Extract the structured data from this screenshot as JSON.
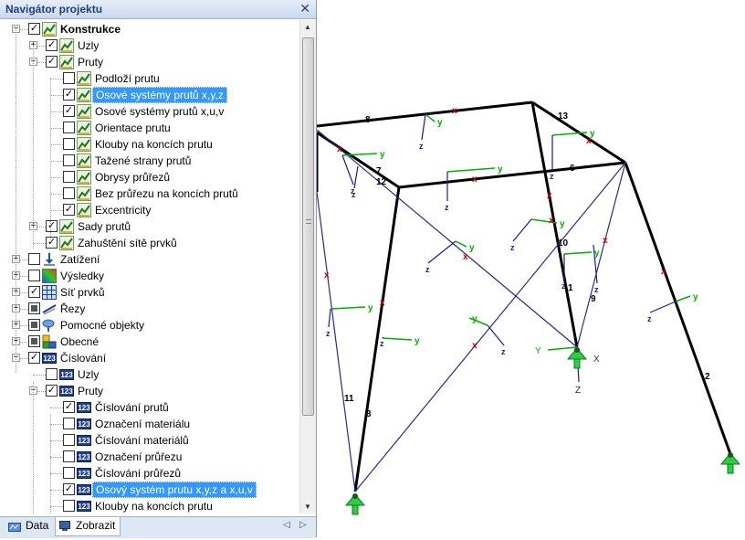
{
  "navigator": {
    "title": "Navigátor projektu",
    "close_glyph": "✕",
    "items": [
      {
        "label": "Konstrukce",
        "level": 1,
        "expander": "minus",
        "checkbox": "checked",
        "icon": "structure-icon",
        "bold": true
      },
      {
        "label": "Uzly",
        "level": 2,
        "expander": "plus",
        "checkbox": "checked",
        "icon": "structure-icon"
      },
      {
        "label": "Pruty",
        "level": 2,
        "expander": "minus",
        "checkbox": "checked",
        "icon": "structure-icon"
      },
      {
        "label": "Podloží prutu",
        "level": 3,
        "checkbox": "unchecked",
        "icon": "structure-icon"
      },
      {
        "label": "Osové systémy prutů x,y,z",
        "level": 3,
        "checkbox": "checked",
        "icon": "structure-icon",
        "selected": true
      },
      {
        "label": "Osové systémy prutů x,u,v",
        "level": 3,
        "checkbox": "checked",
        "icon": "structure-icon"
      },
      {
        "label": "Orientace prutu",
        "level": 3,
        "checkbox": "unchecked",
        "icon": "structure-icon"
      },
      {
        "label": "Klouby na koncích prutu",
        "level": 3,
        "checkbox": "unchecked",
        "icon": "structure-icon"
      },
      {
        "label": "Tažené strany prutů",
        "level": 3,
        "checkbox": "unchecked",
        "icon": "structure-icon"
      },
      {
        "label": "Obrysy průřezů",
        "level": 3,
        "checkbox": "unchecked",
        "icon": "structure-icon"
      },
      {
        "label": "Bez průřezu na koncích prutů",
        "level": 3,
        "checkbox": "unchecked",
        "icon": "structure-icon"
      },
      {
        "label": "Excentricity",
        "level": 3,
        "checkbox": "checked",
        "icon": "structure-icon"
      },
      {
        "label": "Sady prutů",
        "level": 2,
        "expander": "plus",
        "checkbox": "checked",
        "icon": "structure-icon"
      },
      {
        "label": "Zahuštění sítě prvků",
        "level": 2,
        "checkbox": "checked",
        "icon": "structure-icon"
      },
      {
        "label": "Zatížení",
        "level": 1,
        "expander": "plus",
        "checkbox": "unchecked",
        "icon": "load-icon"
      },
      {
        "label": "Výsledky",
        "level": 1,
        "expander": "plus",
        "checkbox": "unchecked",
        "icon": "results-icon"
      },
      {
        "label": "Síť prvků",
        "level": 1,
        "expander": "plus",
        "checkbox": "checked",
        "icon": "mesh-icon"
      },
      {
        "label": "Řezy",
        "level": 1,
        "expander": "plus",
        "checkbox": "partial",
        "icon": "section-cut-icon"
      },
      {
        "label": "Pomocné objekty",
        "level": 1,
        "expander": "plus",
        "checkbox": "partial",
        "icon": "guide-objects-icon"
      },
      {
        "label": "Obecné",
        "level": 1,
        "expander": "plus",
        "checkbox": "partial",
        "icon": "general-icon"
      },
      {
        "label": "Číslování",
        "level": 1,
        "expander": "minus",
        "checkbox": "checked",
        "icon": "numbering-icon"
      },
      {
        "label": "Uzly",
        "level": 2,
        "checkbox": "unchecked",
        "icon": "numbering-icon"
      },
      {
        "label": "Pruty",
        "level": 2,
        "expander": "minus",
        "checkbox": "checked",
        "icon": "numbering-icon"
      },
      {
        "label": "Číslování prutů",
        "level": 3,
        "checkbox": "checked",
        "icon": "numbering-icon"
      },
      {
        "label": "Označení materiálu",
        "level": 3,
        "checkbox": "unchecked",
        "icon": "numbering-icon"
      },
      {
        "label": "Číslování materiálů",
        "level": 3,
        "checkbox": "unchecked",
        "icon": "numbering-icon"
      },
      {
        "label": "Označení průřezu",
        "level": 3,
        "checkbox": "unchecked",
        "icon": "numbering-icon"
      },
      {
        "label": "Číslování průřezů",
        "level": 3,
        "checkbox": "unchecked",
        "icon": "numbering-icon"
      },
      {
        "label": "Osový systém prutu x,y,z a x,u,v",
        "level": 3,
        "checkbox": "checked",
        "icon": "numbering-icon",
        "selected": true
      },
      {
        "label": "Klouby na koncích prutu",
        "level": 3,
        "checkbox": "unchecked",
        "icon": "numbering-icon"
      }
    ],
    "tabs": [
      {
        "label": "Data",
        "icon": "data-icon",
        "active": false
      },
      {
        "label": "Zobrazit",
        "icon": "display-icon",
        "active": true
      }
    ],
    "tab_nav_prev": "◁",
    "tab_nav_next": "▷"
  },
  "viewport": {
    "member_numbers": [
      "1",
      "2",
      "3",
      "6",
      "7",
      "8",
      "9",
      "10",
      "11",
      "12",
      "13"
    ],
    "axis_labels": {
      "y": "y",
      "z": "z",
      "Y": "Y",
      "Z": "Z",
      "X": "X"
    },
    "colors": {
      "member": "#000000",
      "diagonal": "#2a2a8a",
      "axis_y": "#00b000",
      "axis_z": "#1a1aa0",
      "eccentricity": "#cc0000",
      "support": "#2ecc40"
    }
  }
}
